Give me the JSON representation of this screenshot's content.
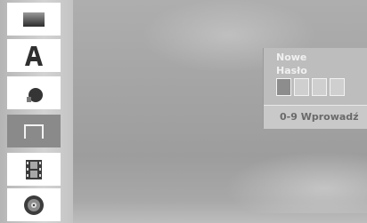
{
  "menu": {
    "items": [
      {
        "icon": "disc-tray-icon",
        "selected": false
      },
      {
        "icon": "font-a-icon",
        "selected": false
      },
      {
        "icon": "audio-speaker-icon",
        "selected": false
      },
      {
        "icon": "lock-frame-icon",
        "selected": true
      },
      {
        "icon": "film-strip-icon",
        "selected": false
      },
      {
        "icon": "dvd-disc-icon",
        "selected": false
      }
    ]
  },
  "password_panel": {
    "label_line1": "Nowe",
    "label_line2": "Hasło",
    "digits": [
      "",
      "",
      "",
      ""
    ],
    "active_digit": 1,
    "hint": "0-9 Wprowadź"
  }
}
